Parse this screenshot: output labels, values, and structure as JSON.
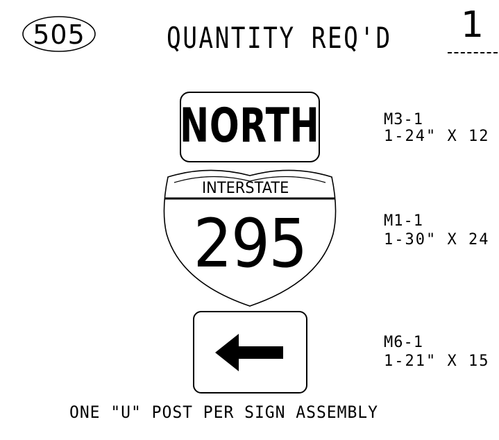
{
  "header": {
    "sheet_number": "505",
    "quantity_label": "QUANTITY REQ'D",
    "quantity_value": "1"
  },
  "signs": [
    {
      "legend": "NORTH",
      "code": "M3-1",
      "size": "1-24\" X 12"
    },
    {
      "banner": "INTERSTATE",
      "route_number": "295",
      "code": "M1-1",
      "size": "1-30\" X 24"
    },
    {
      "arrow_direction": "left",
      "code": "M6-1",
      "size": "1-21\" X 15"
    }
  ],
  "footer": {
    "note": "ONE \"U\" POST PER SIGN ASSEMBLY"
  }
}
